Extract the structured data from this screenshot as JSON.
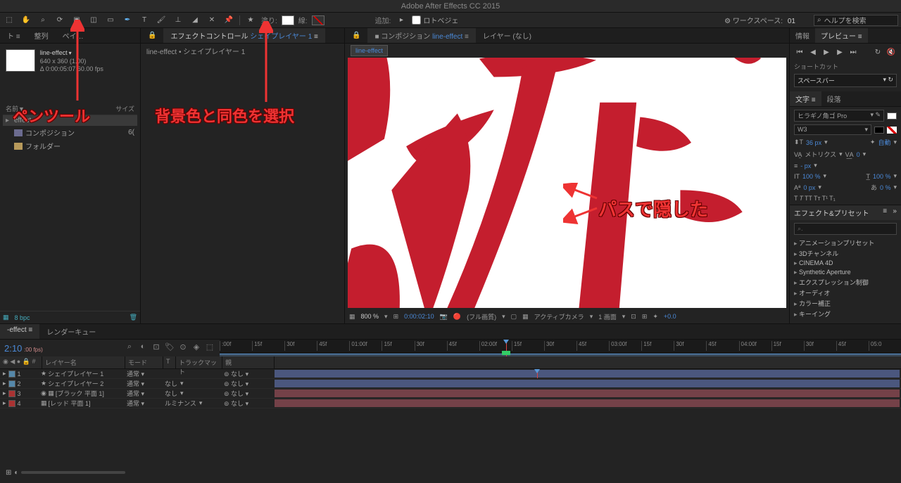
{
  "app": {
    "title": "Adobe After Effects CC 2015"
  },
  "toolbar": {
    "fill_label": "塗り:",
    "stroke_label": "線:",
    "add_label": "追加:",
    "rotobezier_label": "ロトベジェ",
    "workspace_label": "ワークスペース:",
    "workspace_value": "01",
    "search_placeholder": "ヘルプを検索"
  },
  "project": {
    "tab_align": "整列",
    "tab_paint": "ペイ…",
    "name": "line-effect",
    "dims": "640 x 360 (1.00)",
    "duration": "Δ 0:00:05:07 60.00 fps",
    "cols": {
      "name": "名前▼",
      "size": "サイズ"
    },
    "col_effect_label": "effect",
    "items": [
      {
        "label": "コンポジション",
        "count": "6("
      },
      {
        "label": "フォルダー"
      }
    ],
    "bpc": "8 bpc"
  },
  "fx_ctrl": {
    "tab": "エフェクトコントロール ",
    "layer_link": "シェイプレイヤー 1",
    "path": "line-effect • シェイプレイヤー 1"
  },
  "comp": {
    "tab_prefix": "コンポジション ",
    "tab_link": "line-effect",
    "layer_tab": "レイヤー (なし)",
    "sec_tab": "line-effect",
    "footer": {
      "zoom": "800 %",
      "tc": "0:00:02:10",
      "quality": "(フル画質)",
      "camera": "アクティブカメラ",
      "view": "1 画面",
      "offset": "+0.0"
    }
  },
  "right": {
    "tab_info": "情報",
    "tab_preview": "プレビュー",
    "shortcut_label": "ショートカット",
    "shortcut_value": "スペースバー",
    "tab_char": "文字",
    "tab_para": "段落",
    "font_family": "ヒラギノ角ゴ Pro",
    "font_weight": "W3",
    "font_size": "36 px",
    "auto": "自動",
    "metrics_label": "メトリクス",
    "tracking": "0",
    "leading": "- px",
    "vscale": "100 %",
    "hscale": "100 %",
    "baseline": "0 px",
    "tsume": "0 %",
    "fx_panel_title": "エフェクト&プリセット",
    "fx_search": "⌕.",
    "fx_items": [
      "アニメーションプリセット",
      "3Dチャンネル",
      "CINEMA 4D",
      "Synthetic Aperture",
      "エクスプレッション制御",
      "オーディオ",
      "カラー補正",
      "キーイング"
    ]
  },
  "timeline": {
    "tab_comp": "-effect",
    "tab_render": "レンダーキュー",
    "tc_main": "2:10",
    "tc_sub": ":00 fps)",
    "ruler": [
      ":00f",
      "15f",
      "30f",
      "45f",
      "01:00f",
      "15f",
      "30f",
      "45f",
      "02:00f",
      "15f",
      "30f",
      "45f",
      "03:00f",
      "15f",
      "30f",
      "45f",
      "04:00f",
      "15f",
      "30f",
      "45f",
      "05:0"
    ],
    "cols": {
      "idx": "#",
      "name": "レイヤー名",
      "mode": "モード",
      "t": "T",
      "trk": "トラックマット",
      "parent": "親"
    },
    "rows": [
      {
        "n": "1",
        "name": "シェイプレイヤー 1",
        "mode": "通常",
        "trk": "",
        "par": "",
        "color": "blue",
        "star": true
      },
      {
        "n": "2",
        "name": "シェイプレイヤー 2",
        "mode": "通常",
        "trk": "なし",
        "par": "なし",
        "color": "blue",
        "star": true
      },
      {
        "n": "3",
        "name": "[ブラック 平面 1]",
        "mode": "通常",
        "trk": "なし",
        "par": "なし",
        "color": "red"
      },
      {
        "n": "4",
        "name": "[レッド 平面 1]",
        "mode": "通常",
        "trk": "ルミナンス",
        "par": "なし",
        "color": "red"
      }
    ],
    "dropdown_mark": "▾",
    "parent_none": "なし",
    "parent_icon": "⊚"
  },
  "annotations": {
    "pen_tool": "ペンツール",
    "bg_color": "背景色と同色を選択",
    "hidden_path": "パスで隠した"
  }
}
